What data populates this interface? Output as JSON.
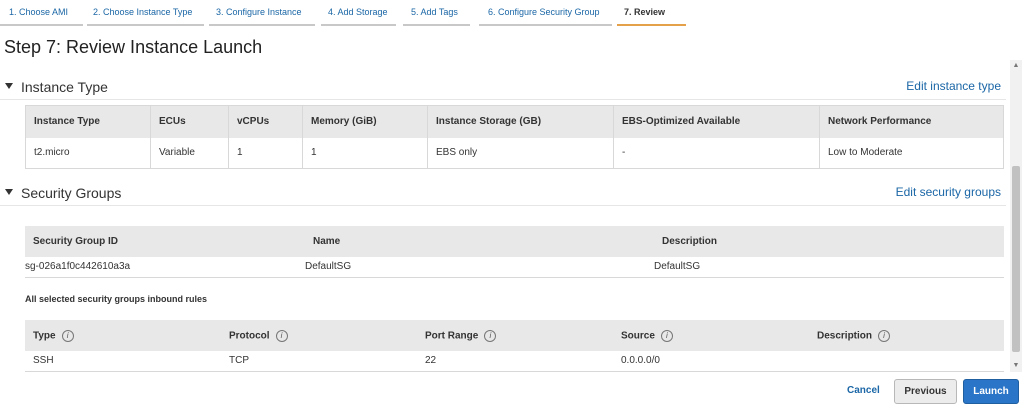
{
  "wizard": {
    "steps": [
      {
        "label": "1. Choose AMI"
      },
      {
        "label": "2. Choose Instance Type"
      },
      {
        "label": "3. Configure Instance"
      },
      {
        "label": "4. Add Storage"
      },
      {
        "label": "5. Add Tags"
      },
      {
        "label": "6. Configure Security Group"
      },
      {
        "label": "7. Review"
      }
    ],
    "active_step": 7
  },
  "page": {
    "title": "Step 7: Review Instance Launch"
  },
  "instance_type": {
    "title": "Instance Type",
    "edit_link": "Edit instance type",
    "columns": [
      "Instance Type",
      "ECUs",
      "vCPUs",
      "Memory (GiB)",
      "Instance Storage (GB)",
      "EBS-Optimized Available",
      "Network Performance"
    ],
    "row": [
      "t2.micro",
      "Variable",
      "1",
      "1",
      "EBS only",
      "-",
      "Low to Moderate"
    ]
  },
  "security_groups": {
    "title": "Security Groups",
    "edit_link": "Edit security groups",
    "columns": [
      "Security Group ID",
      "Name",
      "Description"
    ],
    "row": [
      "sg-026a1f0c442610a3a",
      "DefaultSG",
      "DefaultSG"
    ],
    "inbound_heading": "All selected security groups inbound rules",
    "inbound_columns": [
      "Type",
      "Protocol",
      "Port Range",
      "Source",
      "Description"
    ],
    "inbound_row": [
      "SSH",
      "TCP",
      "22",
      "0.0.0.0/0",
      ""
    ]
  },
  "footer": {
    "cancel": "Cancel",
    "previous": "Previous",
    "launch": "Launch"
  },
  "colors": {
    "link": "#1a66a6",
    "primary_button": "#2a75c7",
    "active_step_underline": "#e4a14a"
  }
}
